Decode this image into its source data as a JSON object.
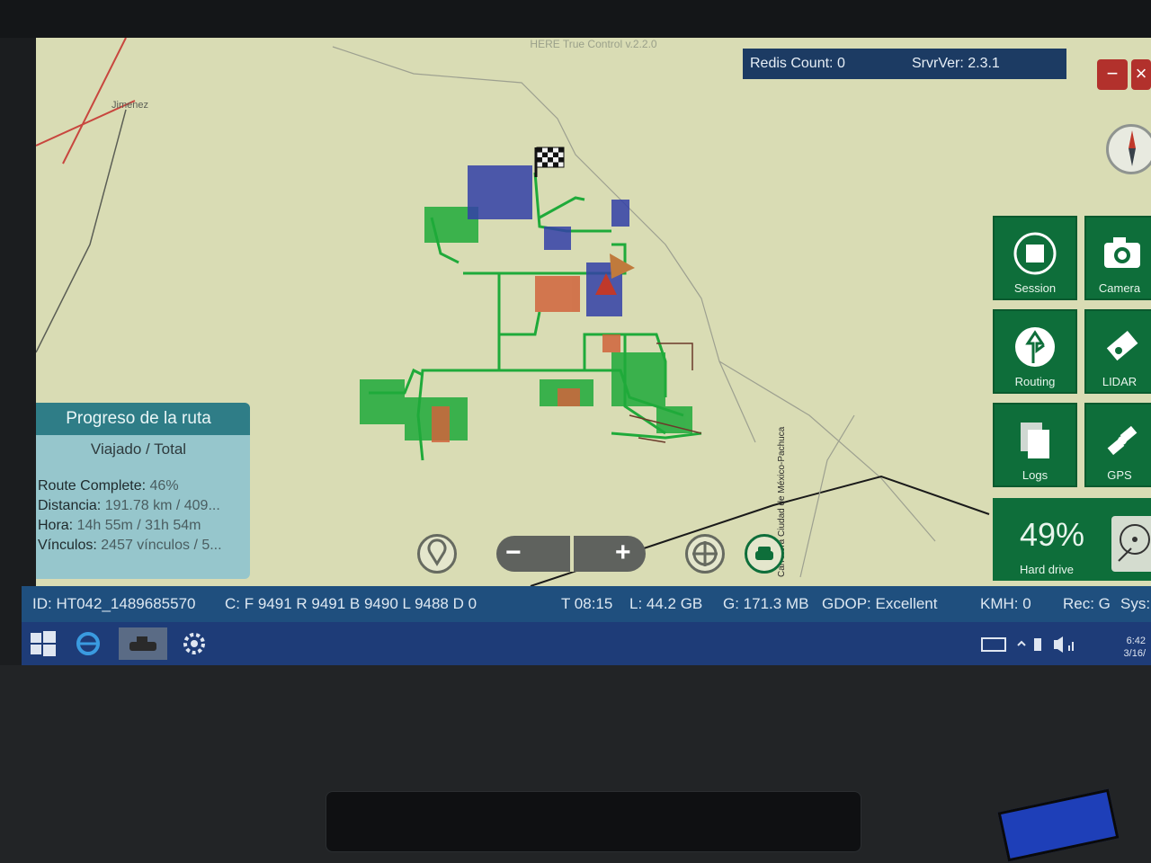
{
  "window": {
    "title": "HERE True Control v.2.2.0"
  },
  "redis_bar": {
    "redis_count": "Redis Count: 0",
    "server_version": "SrvrVer: 2.3.1"
  },
  "map": {
    "place_label": "Jimenez",
    "road_label": "Carretera Ciudad de México-Pachuca",
    "colors": {
      "background": "#d9dcb4",
      "driven": "#1faa3a",
      "planned": "#3340a8",
      "other": "#d0643c"
    }
  },
  "tiles": {
    "session": "Session",
    "camera": "Camera",
    "routing": "Routing",
    "lidar": "LIDAR",
    "logs": "Logs",
    "gps": "GPS"
  },
  "hard_drive": {
    "percent": "49%",
    "label": "Hard drive",
    "fraction_used": 0.49
  },
  "progress_panel": {
    "title": "Progreso de la ruta",
    "subtitle": "Viajado / Total",
    "route_complete_label": "Route Complete:",
    "route_complete_value": "46%",
    "distance_label": "Distancia:",
    "distance_value": "191.78 km / 409...",
    "time_label": "Hora:",
    "time_value": "14h 55m / 31h 54m",
    "links_label": "Vínculos:",
    "links_value": "2457 vínculos / 5..."
  },
  "controls": {
    "minus": "−",
    "plus": "+"
  },
  "status_bar": {
    "id": "ID: HT042_1489685570",
    "counters": "C: F 9491 R 9491 B 9490 L 9488 D 0",
    "time": "T 08:15",
    "disk": "L:  44.2 GB",
    "memory": "G: 171.3 MB",
    "gdop": "GDOP: Excellent",
    "kmh": "KMH: 0",
    "rec": "Rec: G",
    "sys": "Sys:"
  },
  "taskbar": {
    "time": "6:42",
    "date": "3/16/"
  }
}
